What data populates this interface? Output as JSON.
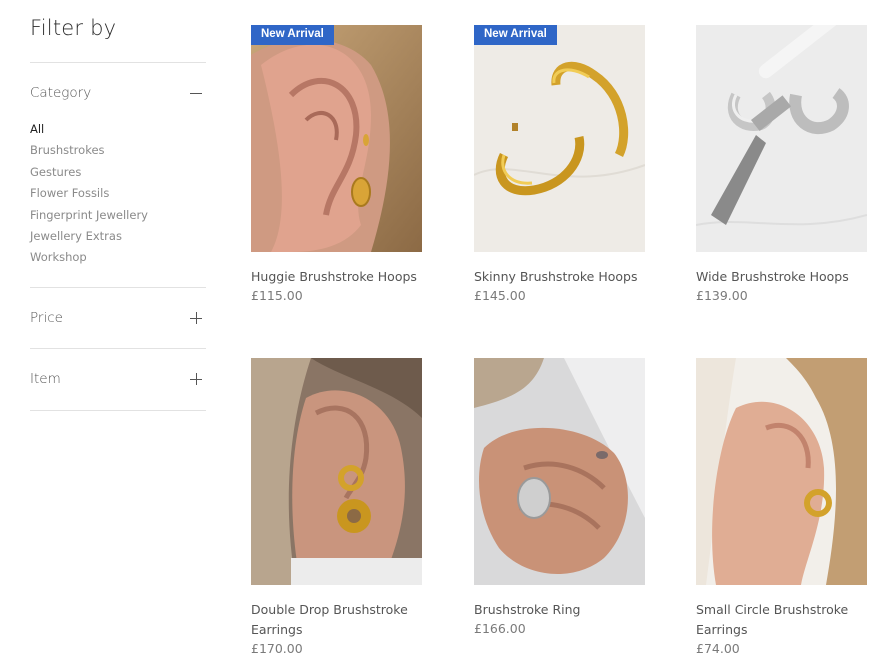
{
  "sidebar": {
    "title": "Filter by",
    "category": {
      "label": "Category",
      "items": [
        "All",
        "Brushstrokes",
        "Gestures",
        "Flower Fossils",
        "Fingerprint Jewellery",
        "Jewellery Extras",
        "Workshop"
      ]
    },
    "price": {
      "label": "Price"
    },
    "item": {
      "label": "Item"
    }
  },
  "products": [
    {
      "name": "Huggie Brushstroke Hoops",
      "price": "£115.00",
      "badge": "New Arrival"
    },
    {
      "name": "Skinny Brushstroke Hoops",
      "price": "£145.00",
      "badge": "New Arrival"
    },
    {
      "name": "Wide Brushstroke Hoops",
      "price": "£139.00"
    },
    {
      "name": "Double Drop Brushstroke Earrings",
      "price": "£170.00"
    },
    {
      "name": "Brushstroke Ring",
      "price": "£166.00"
    },
    {
      "name": "Small Circle Brushstroke Earrings",
      "price": "£74.00"
    }
  ],
  "colors": {
    "badge": "#2f66c7",
    "gold": "#d4a52a",
    "silver": "#c8c8c8"
  }
}
